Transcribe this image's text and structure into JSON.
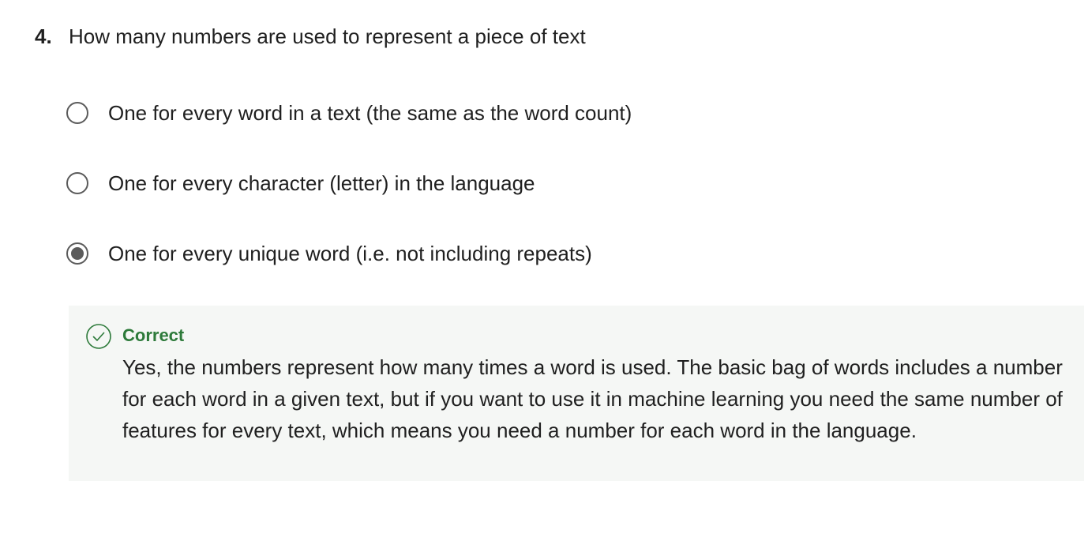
{
  "question": {
    "number": "4.",
    "text": "How many numbers are used to represent a piece of text"
  },
  "options": [
    {
      "label": "One for every word in a text (the same as the word count)",
      "selected": false
    },
    {
      "label": "One for every character (letter) in the language",
      "selected": false
    },
    {
      "label": "One for every unique word (i.e. not including repeats)",
      "selected": true
    }
  ],
  "feedback": {
    "status": "Correct",
    "icon": "check-circle-icon",
    "status_color": "#2d7a3a",
    "message": "Yes, the numbers represent how many times a word is used. The basic bag of words includes a number for each word in a given text, but if you want to use it in machine learning you need the same number of features for every text, which means you need a number for each word in the language."
  }
}
